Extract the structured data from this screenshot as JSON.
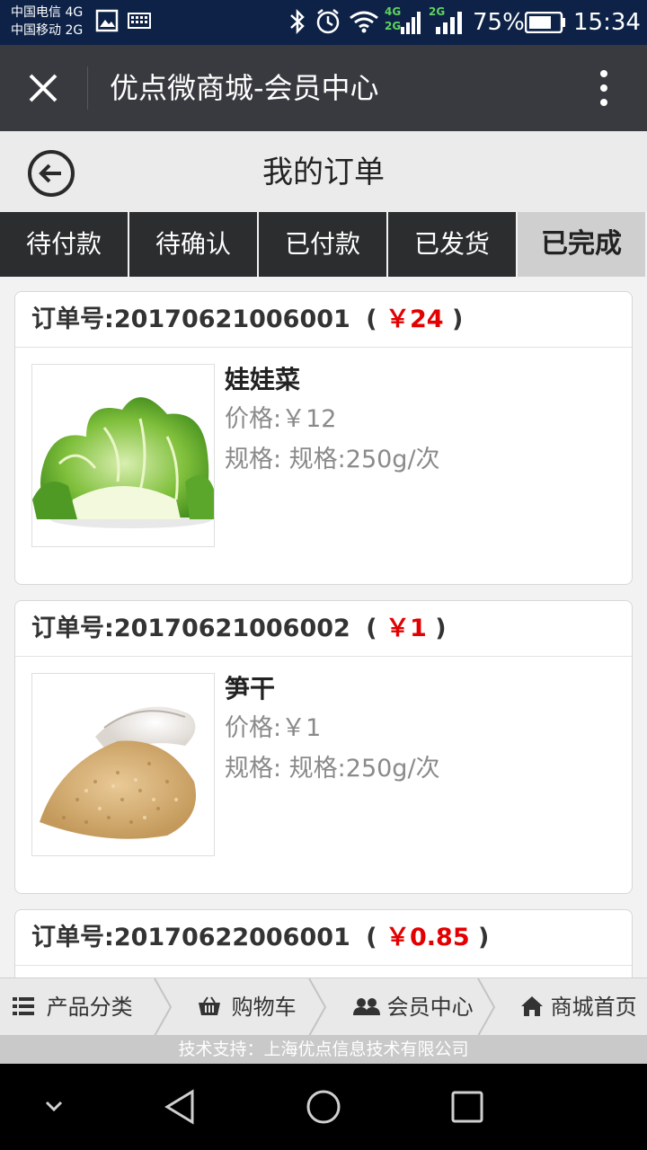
{
  "status_bar": {
    "carrier_1": "中国电信 4G",
    "carrier_2": "中国移动 2G",
    "net_4g": "4G",
    "net_2g_a": "2G",
    "net_2g_b": "2G",
    "battery": "75%",
    "time": "15:34",
    "icons": [
      "image-icon",
      "keyboard-icon",
      "bluetooth-icon",
      "alarm-icon",
      "wifi-icon",
      "signal-icon",
      "battery-icon"
    ]
  },
  "title_bar": {
    "title": "优点微商城-会员中心",
    "close_icon": "close-icon",
    "menu_icon": "more-vert-icon"
  },
  "header": {
    "title": "我的订单",
    "back_icon": "back-arrow-icon"
  },
  "tabs": [
    {
      "label": "待付款",
      "active": false
    },
    {
      "label": "待确认",
      "active": false
    },
    {
      "label": "已付款",
      "active": false
    },
    {
      "label": "已发货",
      "active": false
    },
    {
      "label": "已完成",
      "active": true
    }
  ],
  "orders": [
    {
      "prefix": "订单号:",
      "number": "20170621006001",
      "paren_open": "(",
      "total": "￥24",
      "paren_close": ")",
      "item": {
        "name": "娃娃菜",
        "price": "价格:￥12",
        "spec": "规格: 规格:250g/次",
        "image": "baby-cabbage-image"
      }
    },
    {
      "prefix": "订单号:",
      "number": "20170621006002",
      "paren_open": "(",
      "total": "￥1",
      "paren_close": ")",
      "item": {
        "name": "笋干",
        "price": "价格:￥1",
        "spec": "规格: 规格:250g/次",
        "image": "dried-bamboo-shoot-image"
      }
    },
    {
      "prefix": "订单号:",
      "number": "20170622006001",
      "paren_open": "(",
      "total": "￥0.85",
      "paren_close": ")"
    }
  ],
  "bottom_nav": [
    {
      "label": "产品分类",
      "icon": "list-icon"
    },
    {
      "label": "购物车",
      "icon": "basket-icon"
    },
    {
      "label": "会员中心",
      "icon": "users-icon"
    },
    {
      "label": "商城首页",
      "icon": "home-icon"
    }
  ],
  "footer": {
    "text": "技术支持：上海优点信息技术有限公司"
  },
  "colors": {
    "status_bar": "#0e2247",
    "title_bar": "#393a3f",
    "tab_bg": "#2b2d2e",
    "tab_active": "#cfcfcf",
    "price_red": "#e30000",
    "footer_bg": "#c9c9c9"
  }
}
